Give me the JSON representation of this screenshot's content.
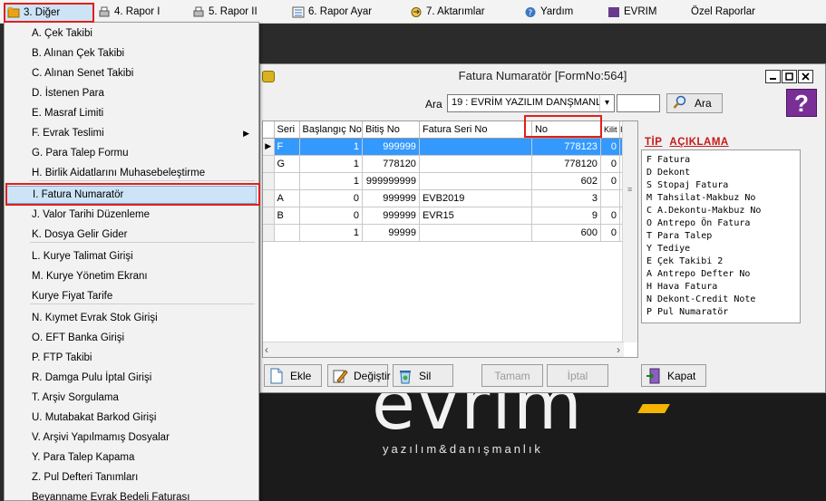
{
  "menubar": {
    "items": [
      {
        "label": "3.  Diğer"
      },
      {
        "label": "4.  Rapor I"
      },
      {
        "label": "5.  Rapor II"
      },
      {
        "label": "6.  Rapor Ayar"
      },
      {
        "label": "7.  Aktarımlar"
      },
      {
        "label": "Yardım"
      },
      {
        "label": "EVRIM"
      },
      {
        "label": "Özel Raporlar"
      }
    ]
  },
  "dropdown": {
    "items": [
      {
        "label": "A.  Çek Takibi"
      },
      {
        "label": "B.  Alınan Çek Takibi"
      },
      {
        "label": "C.  Alınan Senet Takibi"
      },
      {
        "label": "D.  İstenen Para"
      },
      {
        "label": "E.  Masraf Limiti"
      },
      {
        "label": "F.  Evrak Teslimi"
      },
      {
        "label": "G.  Para Talep Formu"
      },
      {
        "label": "H.  Birlik Aidatlarını Muhasebeleştirme"
      },
      {
        "label": "I.  Fatura Numaratör"
      },
      {
        "label": "J.  Valor Tarihi Düzenleme"
      },
      {
        "label": "K.  Dosya Gelir Gider"
      },
      {
        "label": "L.  Kurye Talimat Girişi"
      },
      {
        "label": "M.  Kurye Yönetim Ekranı"
      },
      {
        "label": "Kurye Fiyat Tarife"
      },
      {
        "label": "N.  Kıymet Evrak Stok Girişi"
      },
      {
        "label": "O.  EFT Banka Girişi"
      },
      {
        "label": "P.  FTP Takibi"
      },
      {
        "label": "R.  Damga Pulu İptal  Girişi"
      },
      {
        "label": "T. Arşiv Sorgulama"
      },
      {
        "label": "U. Mutabakat Barkod Girişi"
      },
      {
        "label": "V. Arşivi Yapılmamış Dosyalar"
      },
      {
        "label": "Y.  Para Talep Kapama"
      },
      {
        "label": "Z. Pul Defteri Tanımları"
      },
      {
        "label": "Beyanname Evrak Bedeli Faturası"
      }
    ]
  },
  "dialog": {
    "title": "Fatura Numaratör [FormNo:564]",
    "ara_label": "Ara",
    "ara_select_value": "19 : EVRİM YAZILIM DANŞMANL",
    "ara_input_value": "",
    "ara_button": "Ara",
    "help_label": "?",
    "grid": {
      "columns": [
        "Seri",
        "Başlangıç No",
        "Bitiş No",
        "Fatura Seri No",
        "No",
        "Kilit",
        "I"
      ],
      "rows": [
        [
          "F",
          "1",
          "999999",
          "",
          "778123",
          "0"
        ],
        [
          "G",
          "1",
          "778120",
          "",
          "778120",
          "0"
        ],
        [
          "",
          "1",
          "999999999",
          "",
          "602",
          "0"
        ],
        [
          "A",
          "0",
          "999999",
          "EVB2019",
          "3",
          ""
        ],
        [
          "B",
          "0",
          "999999",
          "EVR15",
          "9",
          "0"
        ],
        [
          "",
          "1",
          "99999",
          "",
          "600",
          "0"
        ]
      ]
    },
    "tip": {
      "header_tip": "TİP",
      "header_desc": "AÇIKLAMA",
      "lines": [
        "F Fatura",
        "D Dekont",
        "S Stopaj Fatura",
        "M Tahsilat-Makbuz No",
        "C A.Dekontu-Makbuz No",
        "O Antrepo Ön Fatura",
        "T Para Talep",
        "Y Tediye",
        "E Çek Takibi 2",
        "A Antrepo Defter No",
        "H Hava Fatura",
        "N Dekont-Credit Note",
        "P Pul Numaratör"
      ]
    },
    "buttons": {
      "ekle": "Ekle",
      "degistir": "Değiştir",
      "sil": "Sil",
      "tamam": "Tamam",
      "iptal": "İptal",
      "kapat": "Kapat"
    }
  },
  "brand": {
    "big": "evrim",
    "sub": "yazılım&danışmanlık"
  },
  "colors": {
    "selection": "#3399ff",
    "highlight_box": "#e0201b",
    "menu_hover": "#cde4f7",
    "help_button": "#7a2f97",
    "tip_header": "#c61818"
  }
}
